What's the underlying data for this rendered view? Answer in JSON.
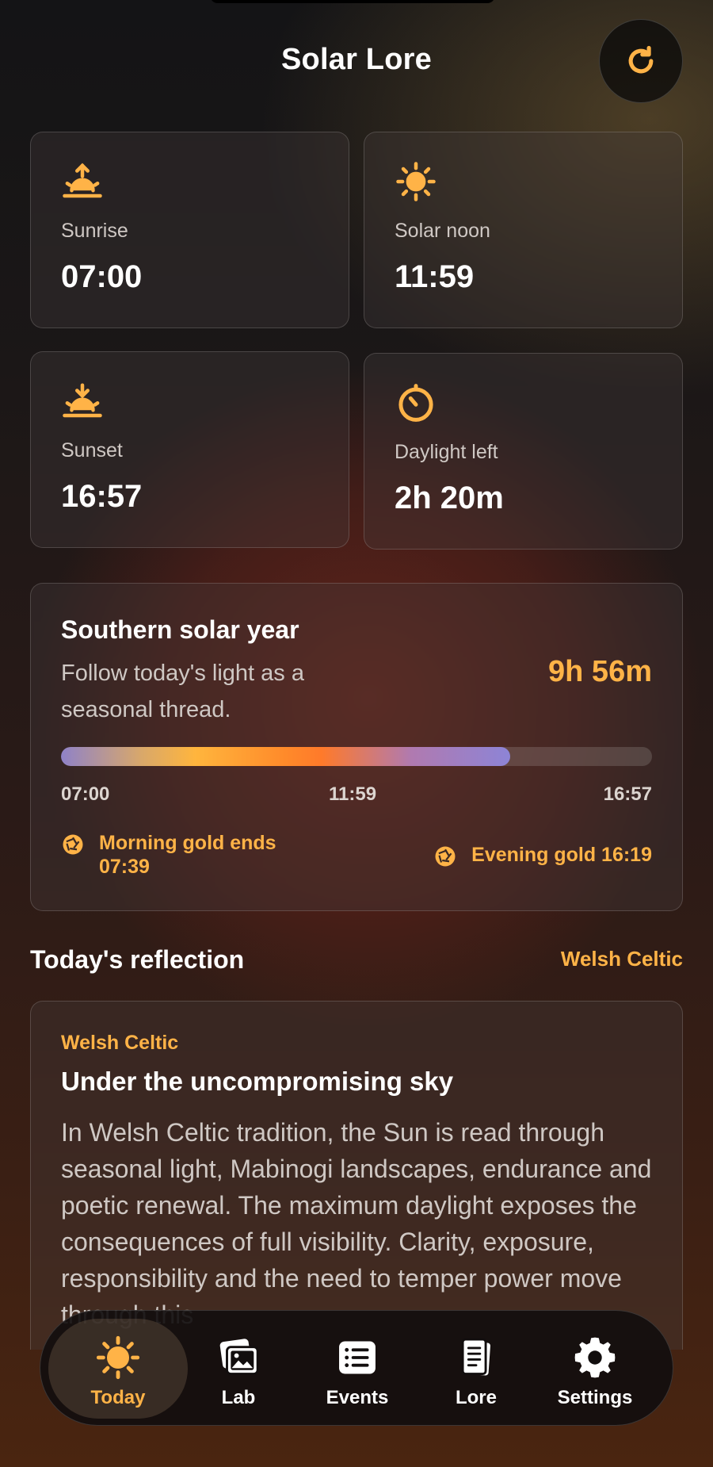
{
  "header": {
    "title": "Solar Lore",
    "refresh_icon": "refresh-icon"
  },
  "stats": {
    "sunrise": {
      "label": "Sunrise",
      "value": "07:00",
      "icon": "sunrise-icon"
    },
    "solar_noon": {
      "label": "Solar noon",
      "value": "11:59",
      "icon": "sun-icon"
    },
    "sunset": {
      "label": "Sunset",
      "value": "16:57",
      "icon": "sunset-icon"
    },
    "daylight_left": {
      "label": "Daylight left",
      "value": "2h 20m",
      "icon": "timer-icon"
    }
  },
  "solar_year": {
    "title": "Southern solar year",
    "subtitle": "Follow today's light as a seasonal thread.",
    "duration": "9h 56m",
    "progress": 0.76,
    "ticks": {
      "start": "07:00",
      "mid": "11:59",
      "end": "16:57"
    },
    "morning_gold": "Morning gold ends 07:39",
    "evening_gold": "Evening gold 16:19"
  },
  "reflection": {
    "section_title": "Today's reflection",
    "section_link": "Welsh Celtic",
    "tag": "Welsh Celtic",
    "title": "Under the uncompromising sky",
    "body": "In Welsh Celtic tradition, the Sun is read through seasonal light, Mabinogi landscapes, endurance and poetic renewal. The maximum daylight exposes the consequences of full visibility. Clarity, exposure, responsibility and the need to temper power move through this"
  },
  "tabs": [
    {
      "label": "Today",
      "icon": "sun-icon",
      "active": true
    },
    {
      "label": "Lab",
      "icon": "photos-icon",
      "active": false
    },
    {
      "label": "Events",
      "icon": "list-icon",
      "active": false
    },
    {
      "label": "Lore",
      "icon": "book-icon",
      "active": false
    },
    {
      "label": "Settings",
      "icon": "gear-icon",
      "active": false
    }
  ],
  "colors": {
    "accent": "#ffb347",
    "background": "#1b1717"
  }
}
